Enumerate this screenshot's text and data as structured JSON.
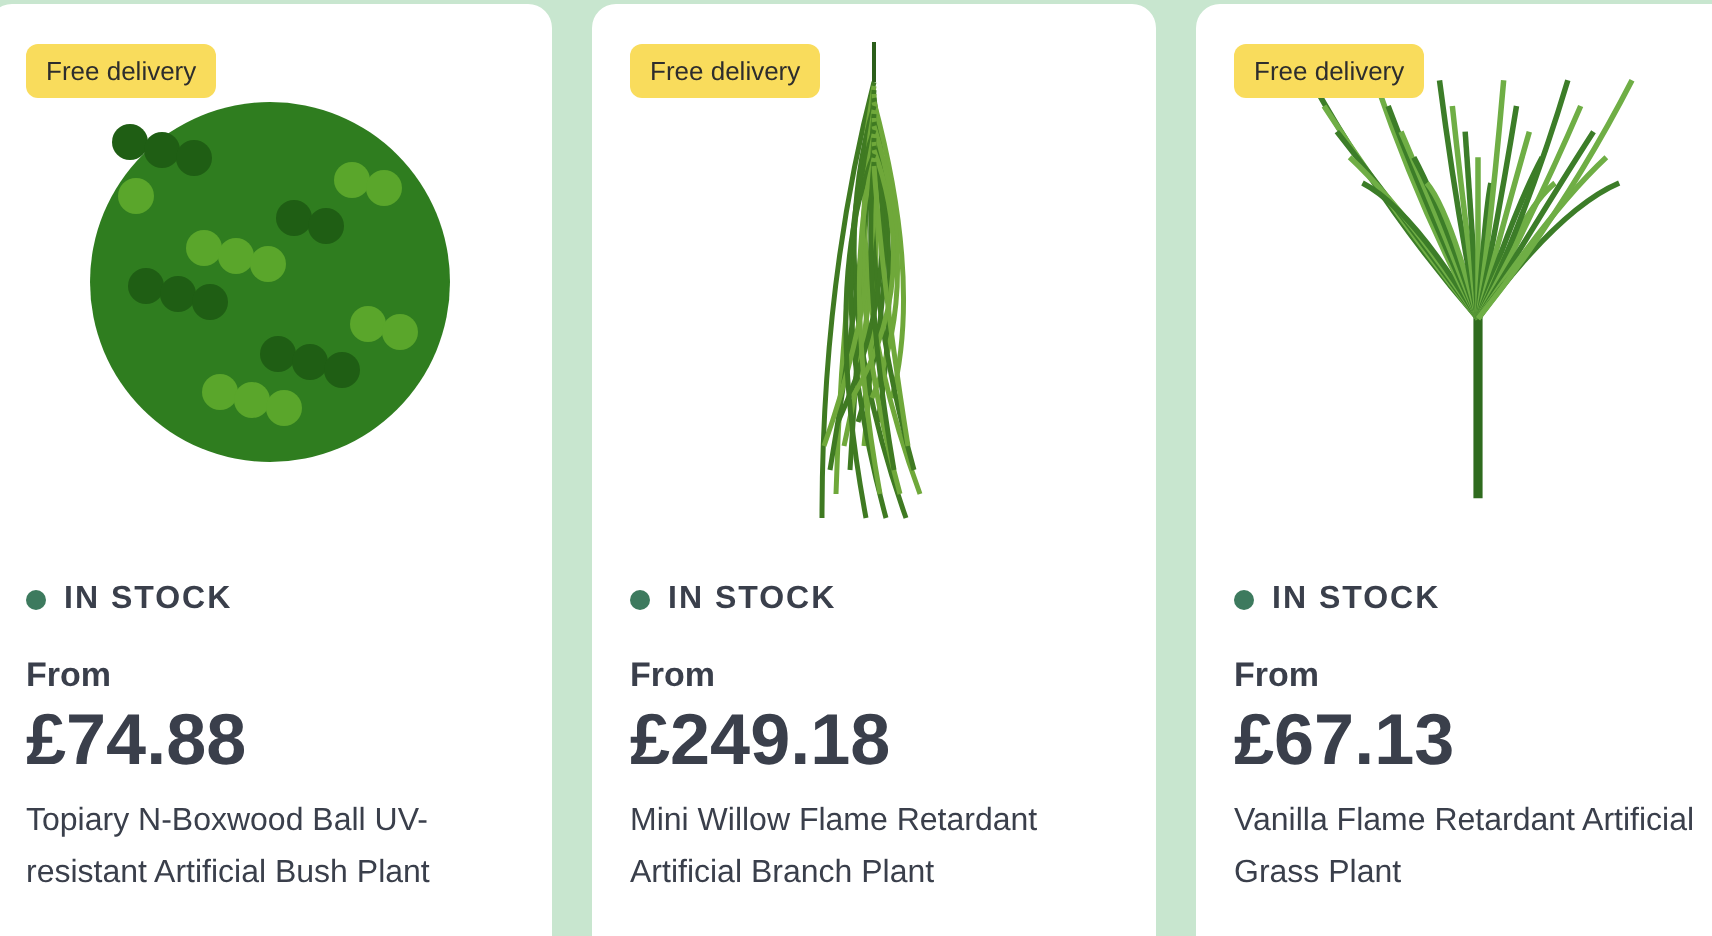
{
  "products": [
    {
      "badge": "Free delivery",
      "kind": "ball",
      "in_stock": true,
      "stock": "IN STOCK",
      "from": "From",
      "price": "£74.88",
      "name": "Topiary N-Boxwood Ball UV-resistant Artificial Bush Plant"
    },
    {
      "badge": "Free delivery",
      "kind": "hanging",
      "in_stock": true,
      "stock": "IN STOCK",
      "from": "From",
      "price": "£249.18",
      "name": "Mini Willow Flame Retardant Artificial Branch Plant"
    },
    {
      "badge": "Free delivery",
      "kind": "grass",
      "in_stock": true,
      "stock": "IN STOCK",
      "from": "From",
      "price": "£67.13",
      "name": "Vanilla Flame Retardant Artificial Grass Plant"
    }
  ]
}
